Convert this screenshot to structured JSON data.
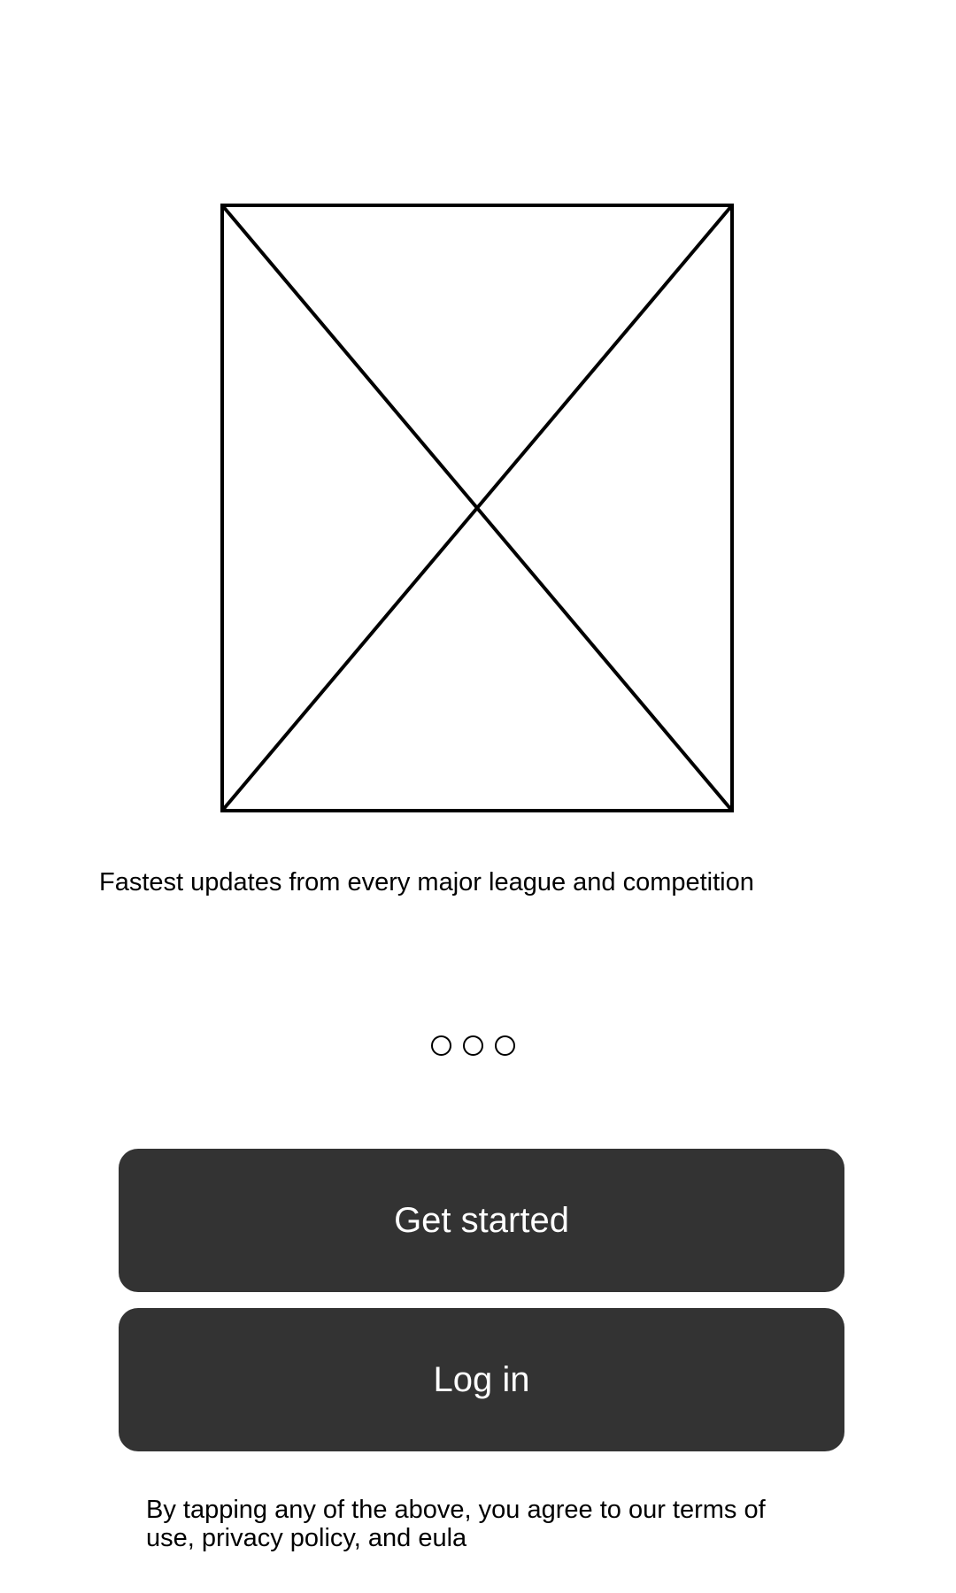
{
  "onboarding": {
    "hero_image": {
      "icon": "image-placeholder-icon",
      "stroke_color": "#000000"
    },
    "tagline": "Fastest updates from every major league and competition",
    "pagination": {
      "count": 3,
      "current": 0
    },
    "buttons": {
      "get_started_label": "Get started",
      "login_label": "Log in",
      "background_color": "#333333",
      "text_color": "#ffffff"
    },
    "legal_text": "By tapping any of the above, you agree to our terms of use, privacy policy, and eula"
  }
}
